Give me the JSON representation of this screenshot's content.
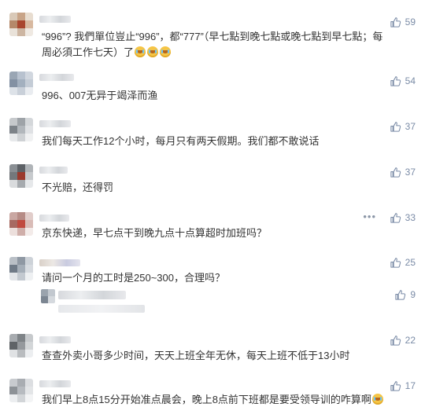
{
  "comments": [
    {
      "text_parts": [
        "“996”? 我們單位豈止“996”，都“777”（早七點到晚七點或晚七點到早七點；每周必須工作七天）了"
      ],
      "likes": "59"
    },
    {
      "text": "996、007无异于竭泽而渔",
      "likes": "54"
    },
    {
      "text": "我们每天工作12个小时，每月只有两天假期。我们都不敢说话",
      "likes": "37"
    },
    {
      "text": "不光赔，还得罚",
      "likes": "37"
    },
    {
      "text": "京东快递，早七点干到晚九点十点算超时加班吗？",
      "likes": "33",
      "more": "•••"
    },
    {
      "text": "请问一个月的工时是250~300，合理吗？",
      "likes": "25",
      "reply_likes": "9"
    },
    {
      "text": "查查外卖小哥多少时间，天天上班全年无休，每天上班不低于13小时",
      "likes": "22"
    },
    {
      "text": "我们早上8点15分开始准点晨会，晚上8点前下班都是要受领导训的咋算啊",
      "likes": "17"
    }
  ],
  "icons": {
    "like": "thumbs-up-icon",
    "emoji": "crying-laughing-emoji-icon",
    "more": "more-dots-icon"
  },
  "colors": {
    "text": "#333333",
    "like": "#7a8ba6",
    "background": "#ffffff"
  }
}
